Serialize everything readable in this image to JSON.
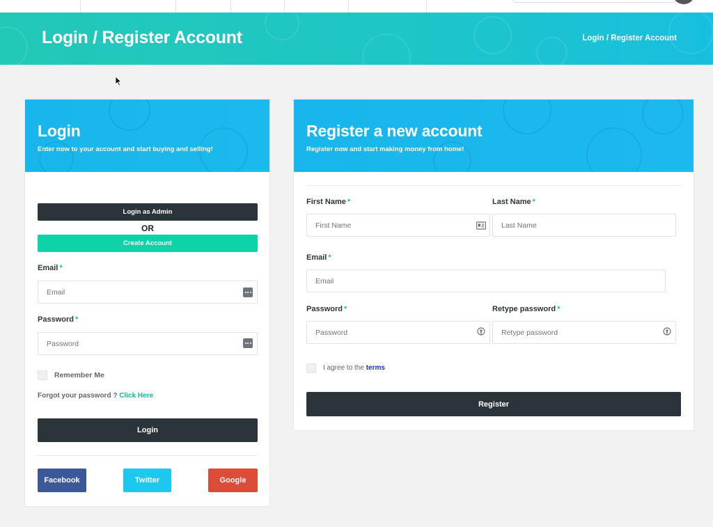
{
  "banner": {
    "title": "Login / Register Account",
    "breadcrumb": "Login / Register Account"
  },
  "login": {
    "title": "Login",
    "subtitle": "Enter now to your account and start buying and selling!",
    "admin_button": "Login as Admin",
    "or_text": "OR",
    "create_button": "Create Account",
    "email_label": "Email",
    "email_placeholder": "Email",
    "password_label": "Password",
    "password_placeholder": "Password",
    "required_mark": "*",
    "remember_label": "Remember Me",
    "forgot_text": "Forgot your password ?",
    "forgot_link": "Click Here",
    "login_button": "Login",
    "social": {
      "facebook": "Facebook",
      "twitter": "Twitter",
      "google": "Google"
    }
  },
  "register": {
    "title": "Register a new account",
    "subtitle": "Register now and start making money from home!",
    "first_name_label": "First Name",
    "first_name_placeholder": "First Name",
    "last_name_label": "Last Name",
    "last_name_placeholder": "Last Name",
    "email_label": "Email",
    "email_placeholder": "Email",
    "password_label": "Password",
    "password_placeholder": "Password",
    "retype_label": "Retype password",
    "retype_placeholder": "Retype password",
    "agree_text": "I agree to the",
    "terms_link": "terms",
    "register_button": "Register"
  },
  "colors": {
    "accent_green": "#0fd3a8",
    "dark_button": "#2b3438",
    "header_blue": "#18b6ec",
    "facebook": "#3b5998",
    "twitter": "#1dc8ee",
    "google": "#dd4b39"
  }
}
